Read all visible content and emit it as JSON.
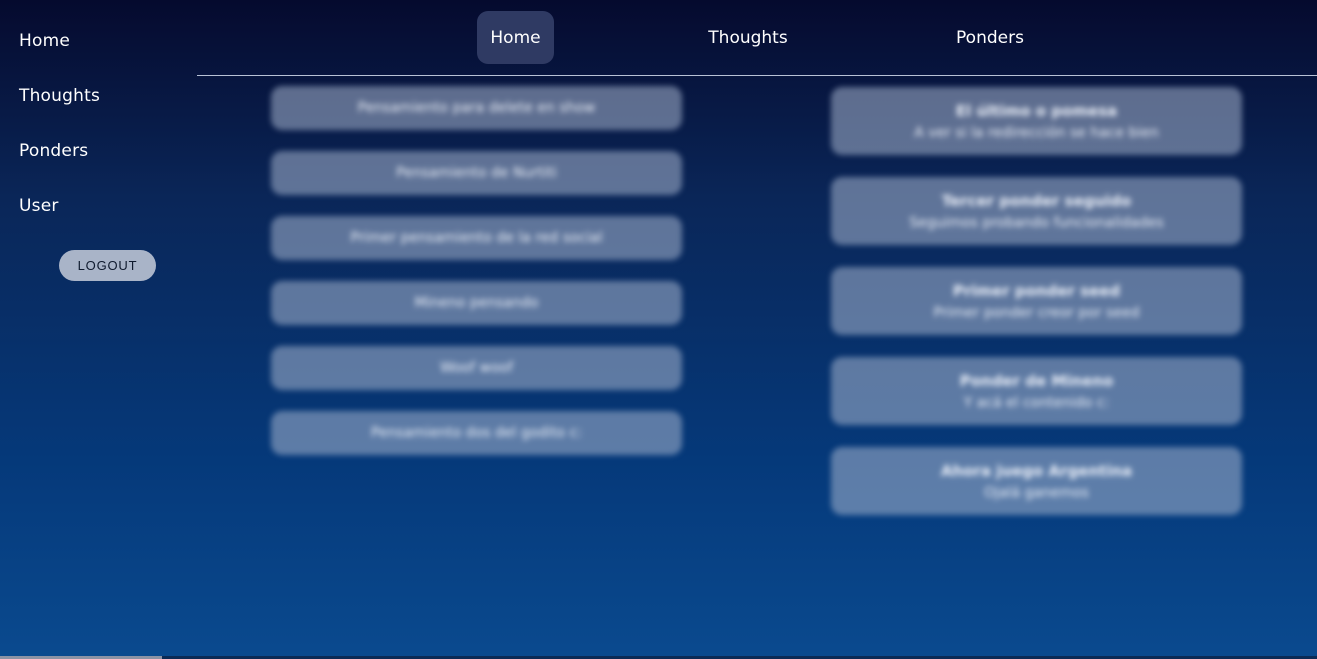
{
  "sidebar": {
    "links": [
      "Home",
      "Thoughts",
      "Ponders",
      "User"
    ],
    "logout_label": "LOGOUT"
  },
  "topnav": {
    "items": [
      "Home",
      "Thoughts",
      "Ponders"
    ],
    "active": "Home"
  },
  "thoughts": [
    "Pensamiento para delete en show",
    "Pensamiento de Nurtiti",
    "Primer pensamiento de la red social",
    "Mineno pensando",
    "Woof woof",
    "Pensamiento dos del godito c:"
  ],
  "ponders": [
    {
      "title": "El último o pomesa",
      "content": "A ver si la redirección se hace bien"
    },
    {
      "title": "Tercer ponder seguido",
      "content": "Seguimos probando funcionalidades"
    },
    {
      "title": "Primer ponder seed",
      "content": "Primer ponder creor por seed"
    },
    {
      "title": "Ponder de Mineno",
      "content": "Y acá el contenido c:"
    },
    {
      "title": "Ahora juego Argentina",
      "content": "Ojalá ganemos"
    }
  ]
}
